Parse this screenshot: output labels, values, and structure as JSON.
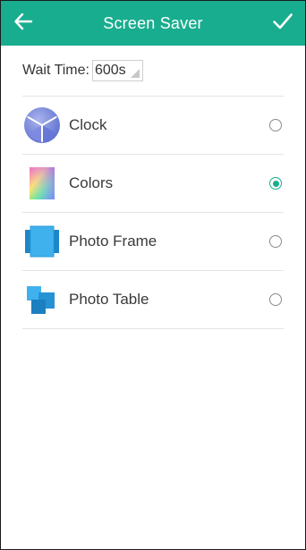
{
  "header": {
    "title": "Screen Saver",
    "background": "#19ad8f",
    "back_icon": "arrow-left-icon",
    "confirm_icon": "check-icon"
  },
  "wait_time": {
    "label": "Wait Time:",
    "value": "600s"
  },
  "options": [
    {
      "label": "Clock",
      "icon": "clock-icon",
      "selected": false
    },
    {
      "label": "Colors",
      "icon": "colors-icon",
      "selected": true
    },
    {
      "label": "Photo Frame",
      "icon": "photo-frame-icon",
      "selected": false
    },
    {
      "label": "Photo Table",
      "icon": "photo-table-icon",
      "selected": false
    }
  ],
  "accent_color": "#19ad8f"
}
